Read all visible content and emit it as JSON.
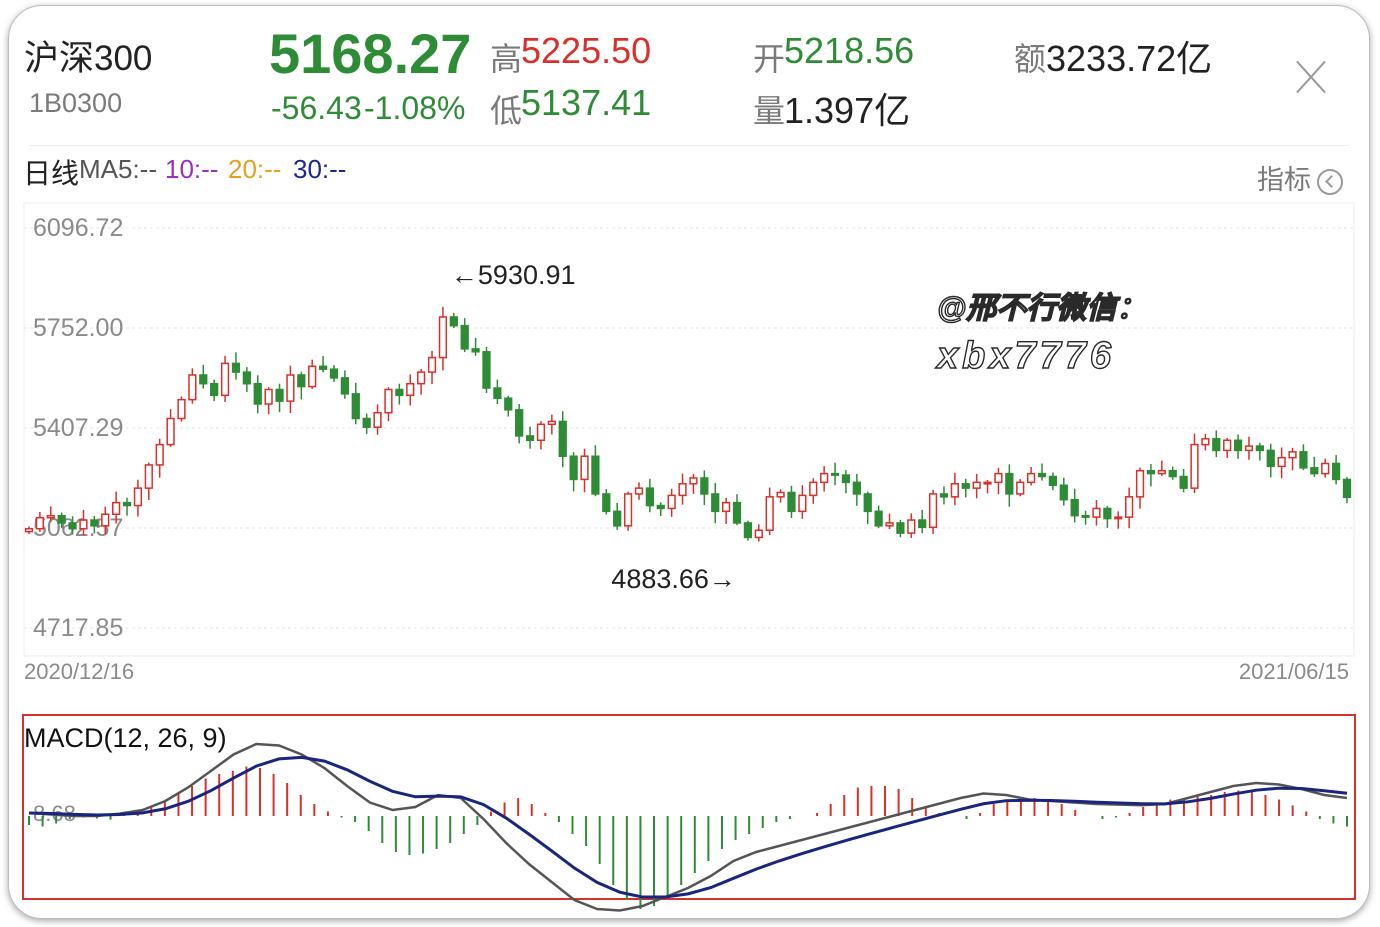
{
  "header": {
    "name": "沪深300",
    "code": "1B0300",
    "price": "5168.27",
    "change": "-56.43",
    "change_pct": "-1.08%",
    "high_label": "高",
    "high": "5225.50",
    "low_label": "低",
    "low": "5137.41",
    "open_label": "开",
    "open": "5218.56",
    "volume_label": "量",
    "volume": "1.397亿",
    "amount_label": "额",
    "amount": "3233.72亿"
  },
  "ma_bar": {
    "period": "日线",
    "ma5": "MA5:--",
    "ma10": "10:--",
    "ma20": "20:--",
    "ma30": "30:--",
    "indicator_label": "指标"
  },
  "watermark": {
    "line1": "@邢不行微信：",
    "line2": "xbx7776"
  },
  "colors": {
    "up": "#d8302b",
    "down": "#2e8b36",
    "ma10": "#9b2fbf",
    "ma20": "#e3a021",
    "ma30": "#1a2a8a",
    "dif": "#555555",
    "dea": "#1a2580",
    "macd_border": "#d8302b"
  },
  "chart_data": [
    {
      "type": "candlestick",
      "y_ticks": [
        "6096.72",
        "5752.00",
        "5407.29",
        "5062.57",
        "4717.85"
      ],
      "ylim": [
        4717.85,
        6096.72
      ],
      "x_start": "2020/12/16",
      "x_end": "2021/06/15",
      "annotations": [
        {
          "text": "←5930.91",
          "value": 5930.91
        },
        {
          "text": "4883.66→",
          "value": 4883.66
        }
      ],
      "closes": [
        5060,
        5098,
        5105,
        5080,
        5060,
        5090,
        5070,
        5110,
        5150,
        5140,
        5200,
        5280,
        5350,
        5440,
        5505,
        5590,
        5560,
        5520,
        5630,
        5600,
        5560,
        5490,
        5540,
        5500,
        5590,
        5550,
        5620,
        5610,
        5580,
        5525,
        5440,
        5410,
        5460,
        5540,
        5520,
        5560,
        5600,
        5650,
        5790,
        5760,
        5680,
        5670,
        5545,
        5510,
        5470,
        5380,
        5365,
        5420,
        5430,
        5310,
        5230,
        5310,
        5180,
        5120,
        5070,
        5180,
        5200,
        5140,
        5130,
        5175,
        5215,
        5235,
        5180,
        5120,
        5150,
        5080,
        5030,
        5055,
        5170,
        5185,
        5120,
        5175,
        5220,
        5250,
        5245,
        5220,
        5180,
        5120,
        5070,
        5080,
        5045,
        5090,
        5065,
        5180,
        5170,
        5215,
        5200,
        5220,
        5220,
        5250,
        5180,
        5220,
        5250,
        5240,
        5210,
        5160,
        5105,
        5100,
        5130,
        5095,
        5100,
        5170,
        5260,
        5250,
        5260,
        5240,
        5200,
        5350,
        5370,
        5330,
        5365,
        5330,
        5345,
        5330,
        5275,
        5305,
        5325,
        5270,
        5250,
        5285,
        5230,
        5168.27
      ]
    },
    {
      "type": "macd",
      "title": "MACD(12, 26, 9)",
      "zero_label": "8.68",
      "hist": [
        -30,
        -35,
        -25,
        -10,
        -5,
        -8,
        -12,
        5,
        15,
        30,
        50,
        75,
        100,
        125,
        140,
        150,
        165,
        160,
        140,
        110,
        70,
        40,
        15,
        -5,
        -20,
        -50,
        -90,
        -120,
        -130,
        -125,
        -110,
        -90,
        -60,
        -30,
        15,
        45,
        60,
        40,
        10,
        -20,
        -60,
        -100,
        -160,
        -230,
        -280,
        -310,
        -300,
        -270,
        -230,
        -190,
        -150,
        -110,
        -80,
        -60,
        -40,
        -20,
        -10,
        0,
        10,
        40,
        70,
        95,
        100,
        100,
        90,
        60,
        30,
        10,
        0,
        -10,
        10,
        40,
        55,
        60,
        60,
        50,
        40,
        20,
        0,
        -10,
        -5,
        10,
        30,
        45,
        55,
        60,
        65,
        70,
        80,
        85,
        80,
        70,
        55,
        35,
        15,
        -10,
        -25,
        -35
      ],
      "dif": [
        10,
        5,
        0,
        0,
        8,
        20,
        50,
        95,
        150,
        205,
        240,
        235,
        205,
        160,
        100,
        45,
        20,
        30,
        70,
        60,
        -10,
        -90,
        -160,
        -220,
        -280,
        -310,
        -315,
        -300,
        -270,
        -240,
        -200,
        -150,
        -120,
        -100,
        -80,
        -60,
        -40,
        -20,
        0,
        20,
        40,
        60,
        75,
        70,
        55,
        50,
        45,
        40,
        38,
        36,
        40,
        60,
        80,
        100,
        110,
        105,
        90,
        70,
        60
      ]
    }
  ]
}
